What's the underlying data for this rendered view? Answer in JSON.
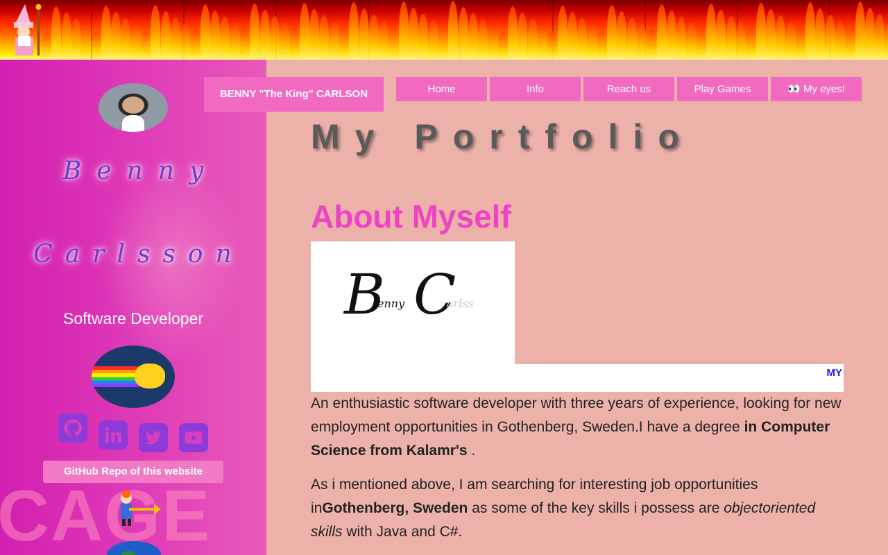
{
  "nav": {
    "brand": "BENNY \"The King\" CARLSON",
    "items": [
      {
        "label": "Home"
      },
      {
        "label": "Info"
      },
      {
        "label": "Reach us"
      },
      {
        "label": "Play Games"
      },
      {
        "label": "👀 My eyes!"
      }
    ]
  },
  "sidebar": {
    "first_name": "Benny",
    "last_name": "Carlsson",
    "role": "Software Developer",
    "github_repo_label": "GitHub Repo of this website",
    "background_text": "CAGE",
    "social": [
      {
        "icon": "github-icon"
      },
      {
        "icon": "linkedin-icon"
      },
      {
        "icon": "twitter-icon"
      },
      {
        "icon": "youtube-icon"
      }
    ]
  },
  "main": {
    "title": "My Portfolio",
    "about_heading": "About Myself",
    "logo": {
      "b": "B",
      "enny": "enny",
      "c": "C",
      "arlss": "arlss"
    },
    "ticker": "MY",
    "p1": {
      "t1": "An enthusiastic software developer with three years of experience, looking for new employment opportunities in Gothenberg, Sweden.I have a degree ",
      "b1": "in Computer Science from Kalamr's",
      "t2": " ."
    },
    "p2": {
      "t1": "As i mentioned above, I am searching for interesting job opportunities in",
      "b1": "Gothenberg, Sweden",
      "t2": " as some of the key skills i possess are ",
      "i1": "objectoriented skills",
      "t3": " with Java and C#."
    }
  },
  "colors": {
    "accent_pink": "#f26ac0",
    "heading_pink": "#ee44c4",
    "page_bg": "#ecb2aa",
    "sidebar_magenta": "#d21fb0"
  }
}
